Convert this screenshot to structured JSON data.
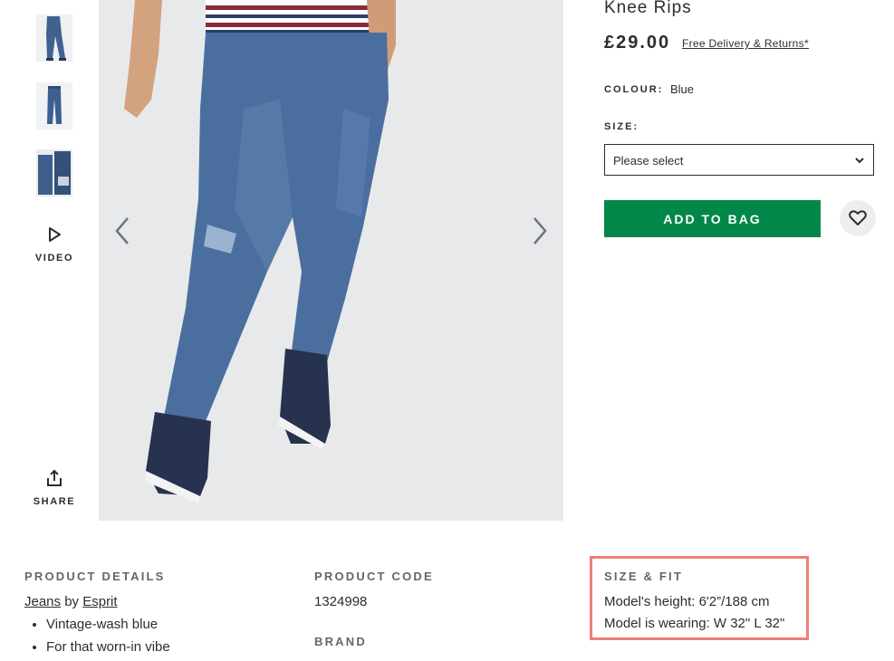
{
  "product": {
    "title": "Knee Rips",
    "price": "£29.00",
    "delivery_link": "Free Delivery & Returns*",
    "colour_label": "COLOUR:",
    "colour_value": "Blue",
    "size_label": "SIZE:",
    "size_placeholder": "Please select",
    "add_to_bag": "ADD TO BAG"
  },
  "gallery": {
    "video_label": "VIDEO",
    "share_label": "SHARE"
  },
  "details": {
    "product_details_heading": "PRODUCT DETAILS",
    "category_link": "Jeans",
    "by_text": "by",
    "brand_link": "Esprit",
    "bullets": [
      "Vintage-wash blue",
      "For that worn-in vibe"
    ],
    "product_code_heading": "PRODUCT CODE",
    "product_code": "1324998",
    "brand_heading": "BRAND",
    "size_fit_heading": "SIZE & FIT",
    "model_height": "Model's height: 6'2”/188 cm",
    "model_wearing": "Model is wearing: W 32\" L 32\""
  },
  "colors": {
    "add_button": "#018849",
    "highlight": "#ef7f79",
    "text": "#2d2d2d"
  },
  "icons": [
    "play-icon",
    "share-icon",
    "chevron-left-icon",
    "chevron-right-icon",
    "chevron-down-icon",
    "heart-icon"
  ]
}
